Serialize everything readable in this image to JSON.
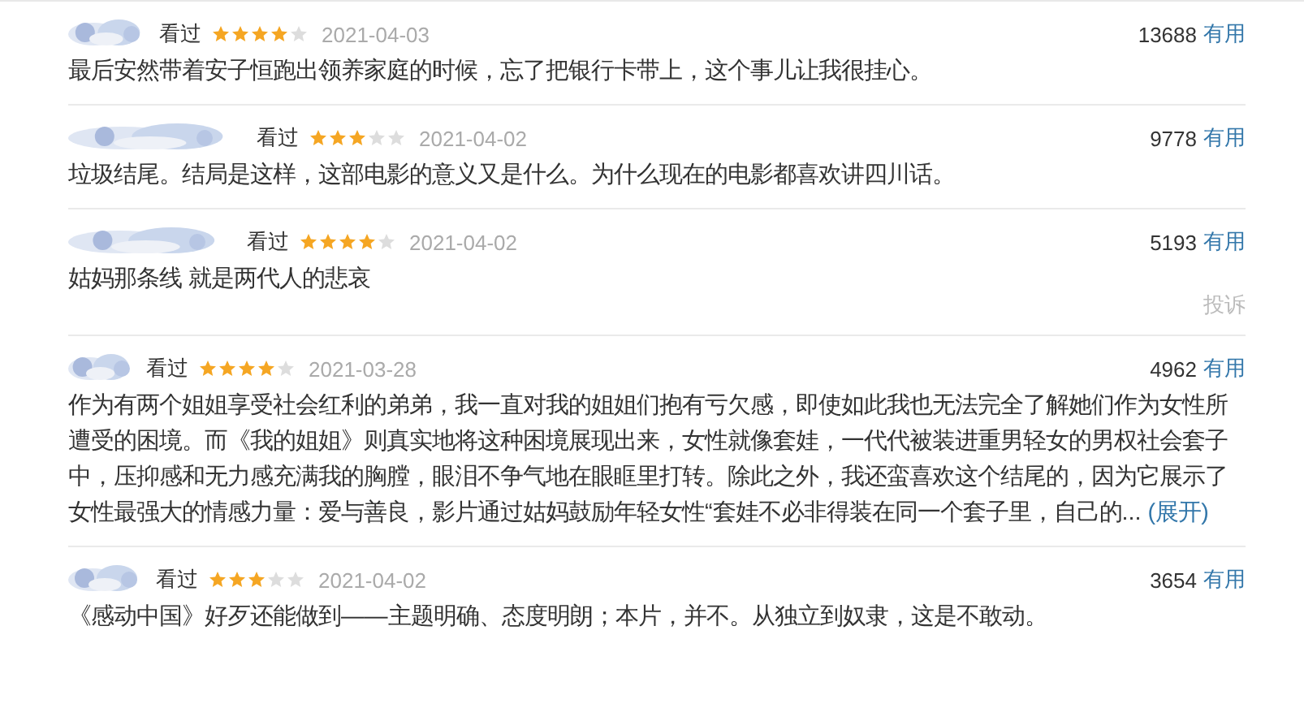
{
  "comments": [
    {
      "status": "看过",
      "stars": 4,
      "date": "2021-04-03",
      "votes": "13688",
      "vote_label": "有用",
      "text": "最后安然带着安子恒跑出领养家庭的时候，忘了把银行卡带上，这个事儿让我很挂心。"
    },
    {
      "status": "看过",
      "stars": 3,
      "date": "2021-04-02",
      "votes": "9778",
      "vote_label": "有用",
      "text": "垃圾结尾。结局是这样，这部电影的意义又是什么。为什么现在的电影都喜欢讲四川话。"
    },
    {
      "status": "看过",
      "stars": 4,
      "date": "2021-04-02",
      "votes": "5193",
      "vote_label": "有用",
      "text": "姑妈那条线 就是两代人的悲哀",
      "report": "投诉"
    },
    {
      "status": "看过",
      "stars": 4,
      "date": "2021-03-28",
      "votes": "4962",
      "vote_label": "有用",
      "text": "作为有两个姐姐享受社会红利的弟弟，我一直对我的姐姐们抱有亏欠感，即使如此我也无法完全了解她们作为女性所遭受的困境。而《我的姐姐》则真实地将这种困境展现出来，女性就像套娃，一代代被装进重男轻女的男权社会套子中，压抑感和无力感充满我的胸膛，眼泪不争气地在眼眶里打转。除此之外，我还蛮喜欢这个结尾的，因为它展示了女性最强大的情感力量：爱与善良，影片通过姑妈鼓励年轻女性“套娃不必非得装在同一个套子里，自己的...",
      "expand": "(展开)"
    },
    {
      "status": "看过",
      "stars": 3,
      "date": "2021-04-02",
      "votes": "3654",
      "vote_label": "有用",
      "text": "《感动中国》好歹还能做到——主题明确、态度明朗；本片，并不。从独立到奴隶，这是不敢动。"
    }
  ]
}
